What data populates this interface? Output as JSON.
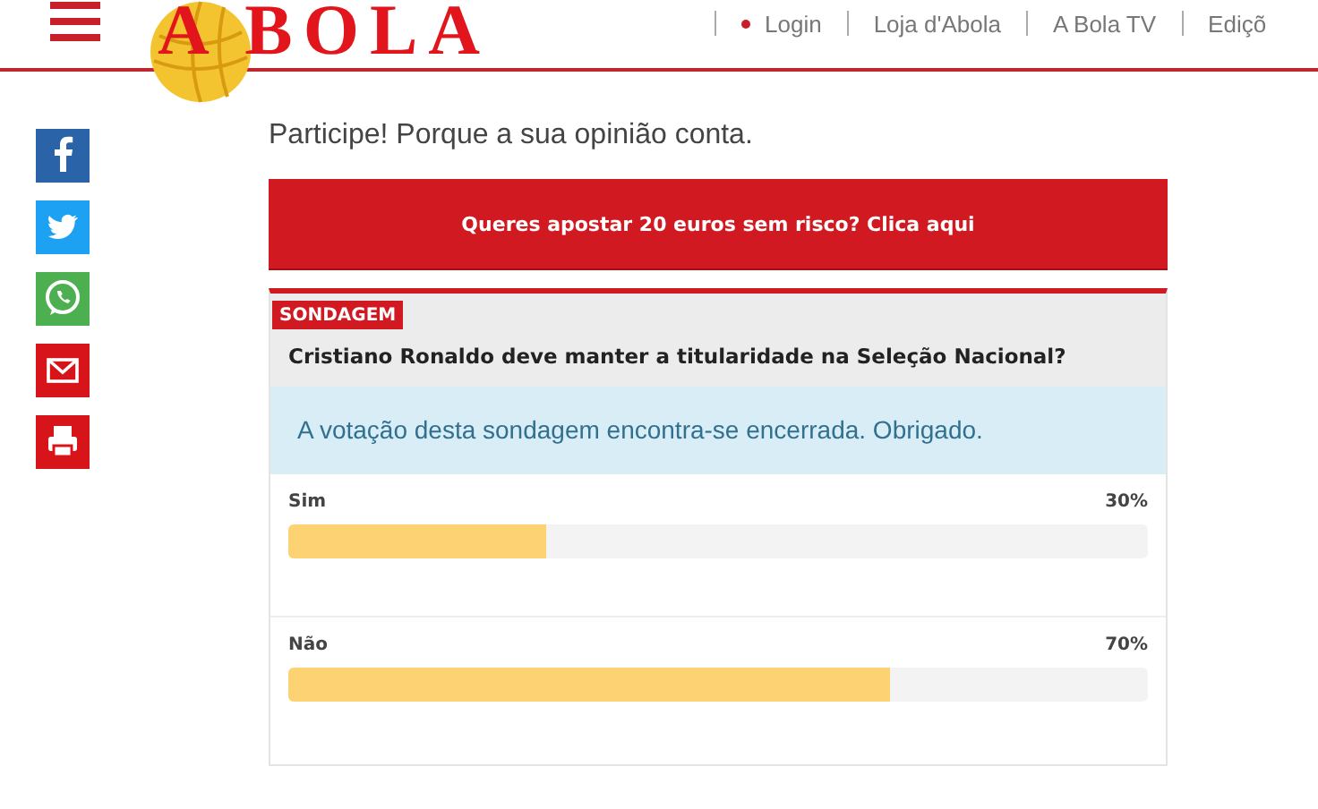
{
  "header": {
    "logo": "A BOLA",
    "nav": [
      {
        "label": "Login",
        "dot": true
      },
      {
        "label": "Loja d'Abola",
        "dot": false
      },
      {
        "label": "A Bola TV",
        "dot": false
      },
      {
        "label": "Ediçõ",
        "dot": false
      }
    ]
  },
  "share": [
    {
      "kind": "facebook"
    },
    {
      "kind": "twitter"
    },
    {
      "kind": "whatsapp"
    },
    {
      "kind": "email"
    },
    {
      "kind": "print"
    }
  ],
  "intro": "Participe! Porque a sua opinião conta.",
  "banner": "Queres apostar 20 euros sem risco? Clica aqui",
  "poll": {
    "tag": "SONDAGEM",
    "question": "Cristiano Ronaldo deve manter a titularidade na Seleção Nacional?",
    "notice": "A votação desta sondagem encontra-se encerrada. Obrigado.",
    "options": [
      {
        "label": "Sim",
        "percent": "30%",
        "level": 0.3
      },
      {
        "label": "Não",
        "percent": "70%",
        "level": 0.7
      }
    ]
  }
}
